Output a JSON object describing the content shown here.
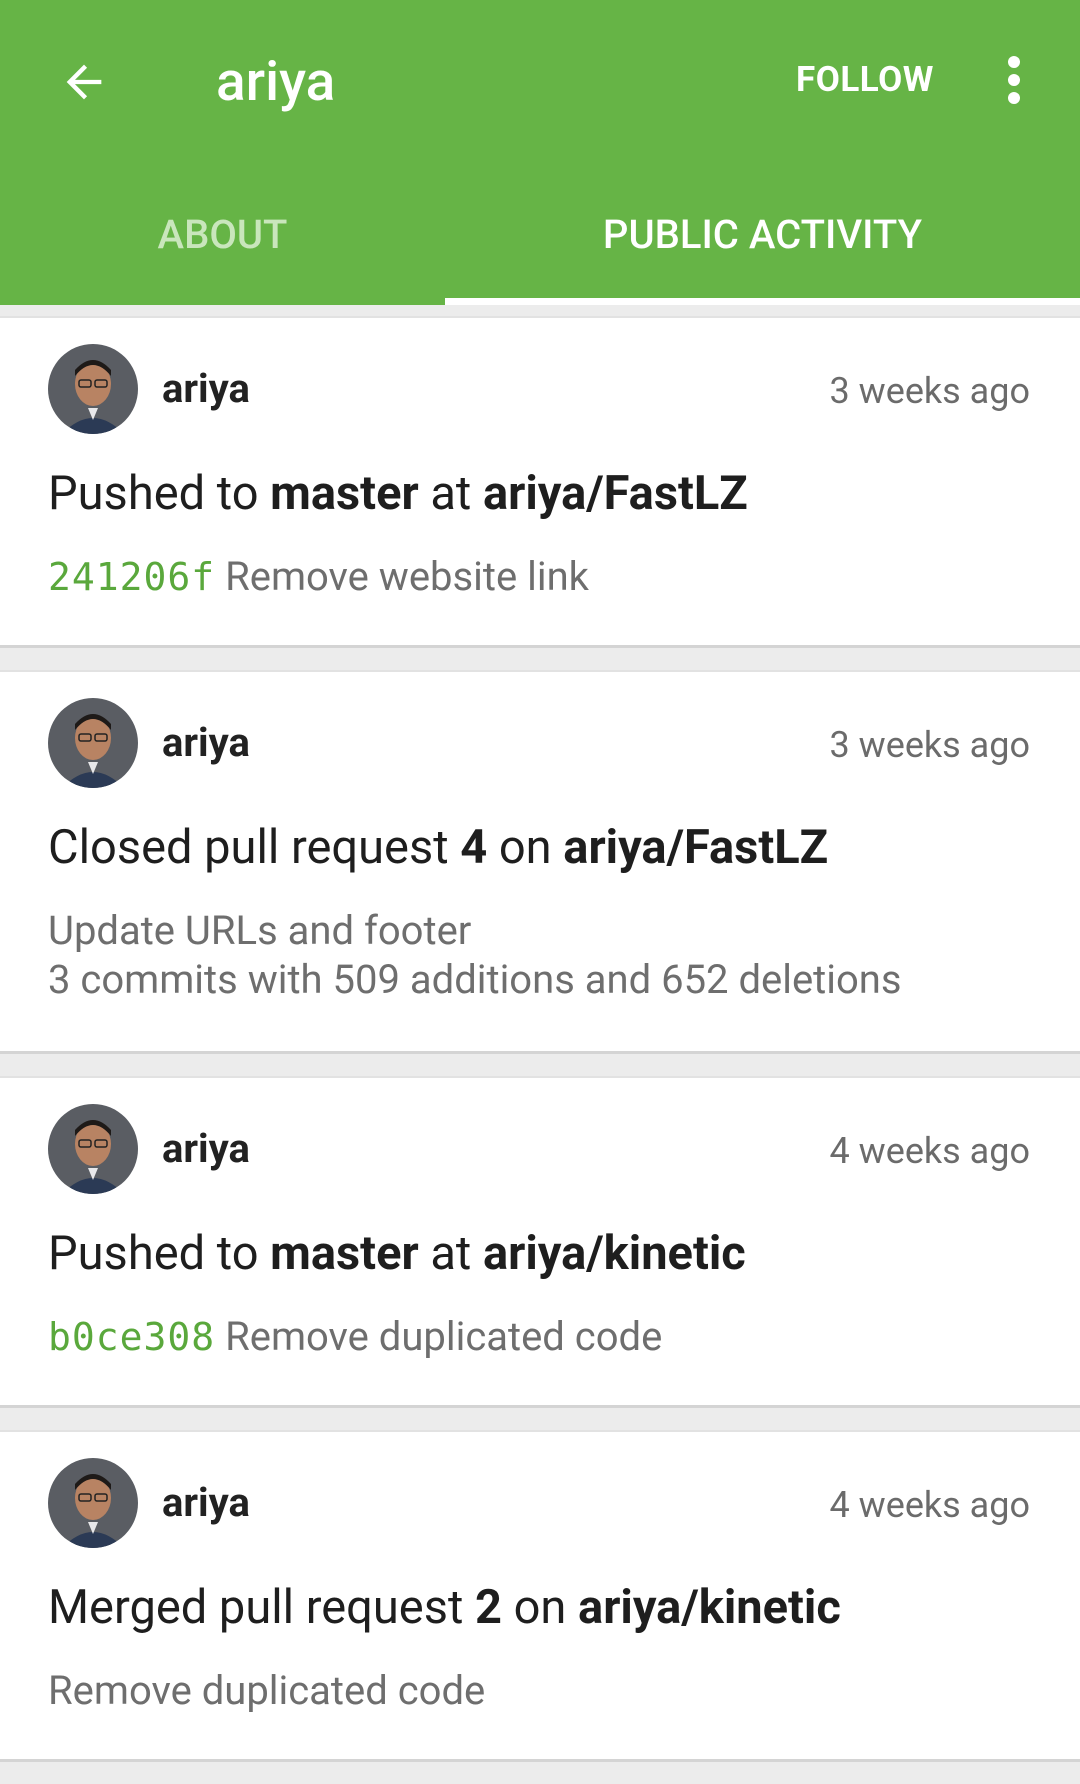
{
  "appbar": {
    "title": "ariya",
    "follow_label": "FOLLOW",
    "accent_color": "#66b446",
    "back_icon": "arrow-left-icon",
    "more_icon": "more-vert-icon"
  },
  "tabs": [
    {
      "label": "ABOUT",
      "active": false
    },
    {
      "label": "PUBLIC ACTIVITY",
      "active": true
    }
  ],
  "feed": [
    {
      "user": "ariya",
      "time": "3 weeks ago",
      "headline": {
        "pre": "Pushed to ",
        "b1": "master",
        "mid": " at ",
        "b2": "ariya/FastLZ"
      },
      "commit": {
        "sha": "241206f",
        "message": "Remove website link"
      }
    },
    {
      "user": "ariya",
      "time": "3 weeks ago",
      "headline": {
        "pre": "Closed pull request ",
        "b1": "4",
        "mid": " on ",
        "b2": "ariya/FastLZ"
      },
      "details": [
        "Update URLs and footer",
        "3 commits with 509 additions and 652 deletions"
      ]
    },
    {
      "user": "ariya",
      "time": "4 weeks ago",
      "headline": {
        "pre": "Pushed to ",
        "b1": "master",
        "mid": " at ",
        "b2": "ariya/kinetic"
      },
      "commit": {
        "sha": "b0ce308",
        "message": "Remove duplicated code"
      }
    },
    {
      "user": "ariya",
      "time": "4 weeks ago",
      "headline": {
        "pre": "Merged pull request ",
        "b1": "2",
        "mid": " on ",
        "b2": "ariya/kinetic"
      },
      "details": [
        "Remove duplicated code"
      ]
    }
  ]
}
